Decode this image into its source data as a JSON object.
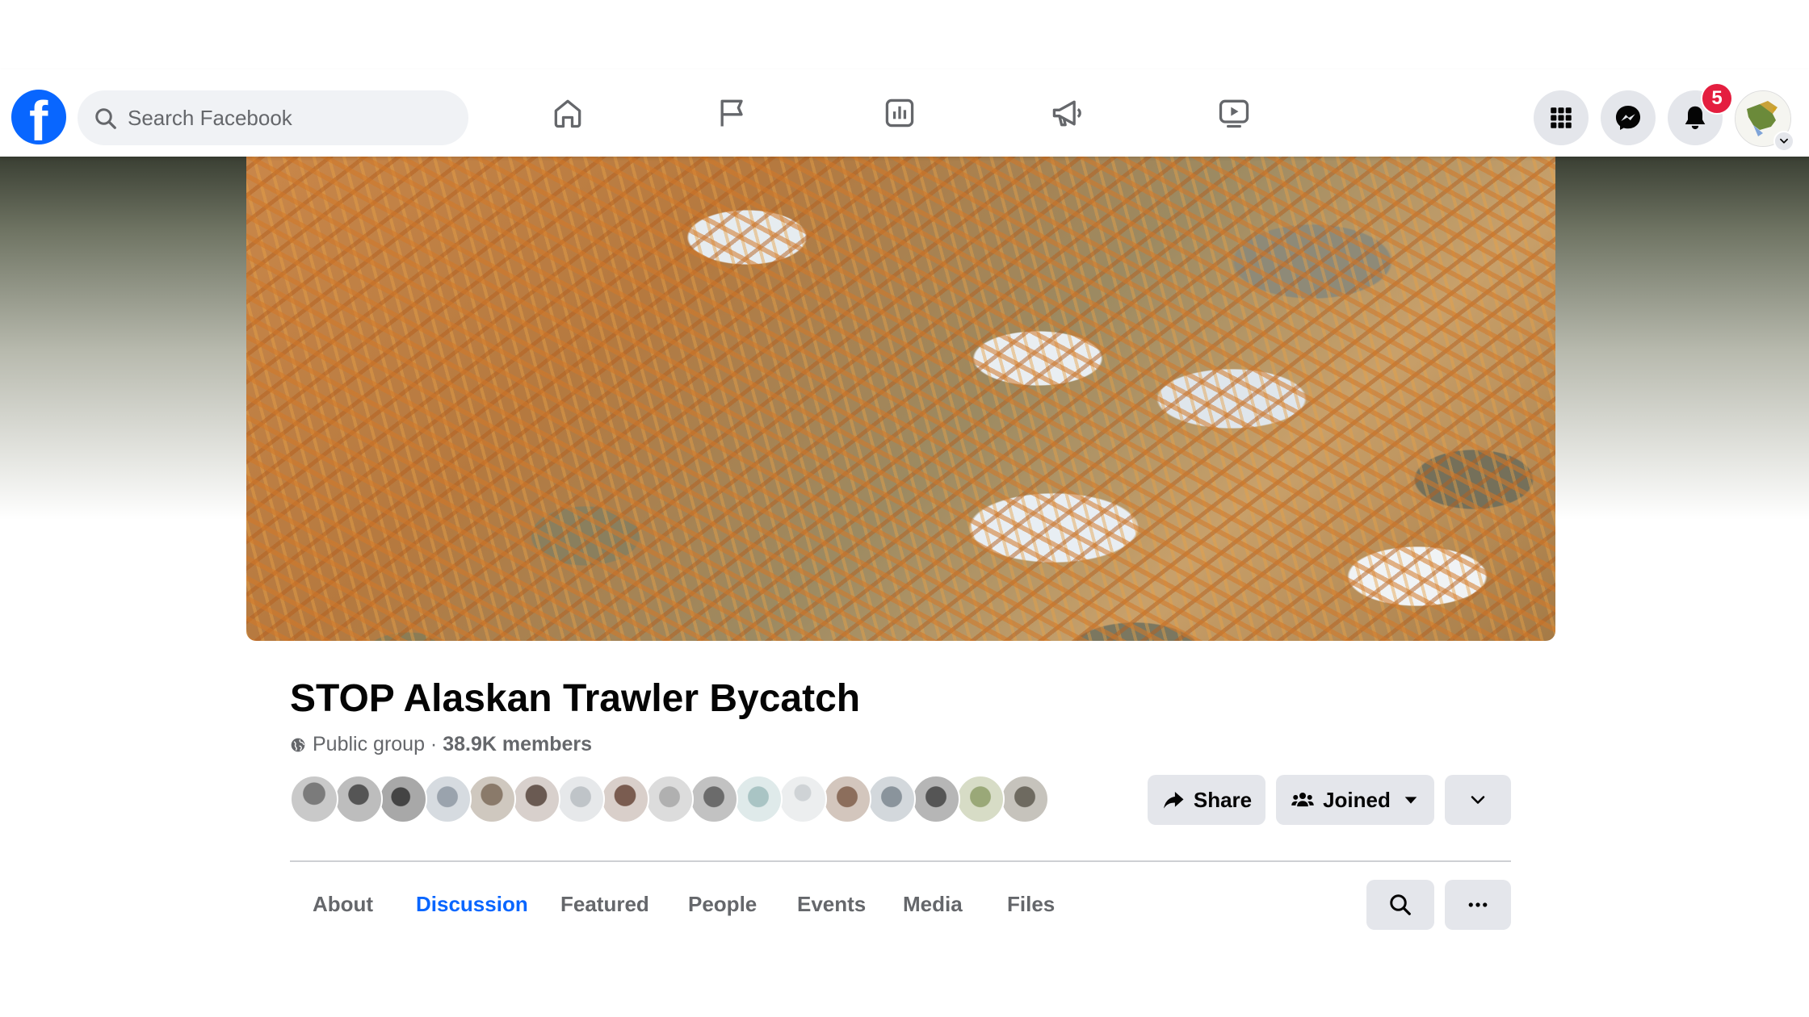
{
  "brand": {
    "color": "#0866ff"
  },
  "search": {
    "placeholder": "Search Facebook"
  },
  "nav_icons": [
    "home-icon",
    "pages-flag-icon",
    "insights-icon",
    "ads-megaphone-icon",
    "watch-video-icon"
  ],
  "right_icons": [
    "menu-grid-icon",
    "messenger-icon",
    "notifications-bell-icon"
  ],
  "notifications": {
    "count": "5"
  },
  "group": {
    "name": "STOP Alaskan Trawler Bycatch",
    "privacy": "Public group",
    "separator": " · ",
    "members": "38.9K members"
  },
  "actions": {
    "share": "Share",
    "joined": "Joined"
  },
  "tabs": [
    "About",
    "Discussion",
    "Featured",
    "People",
    "Events",
    "Media",
    "Files"
  ],
  "active_tab": "Discussion"
}
